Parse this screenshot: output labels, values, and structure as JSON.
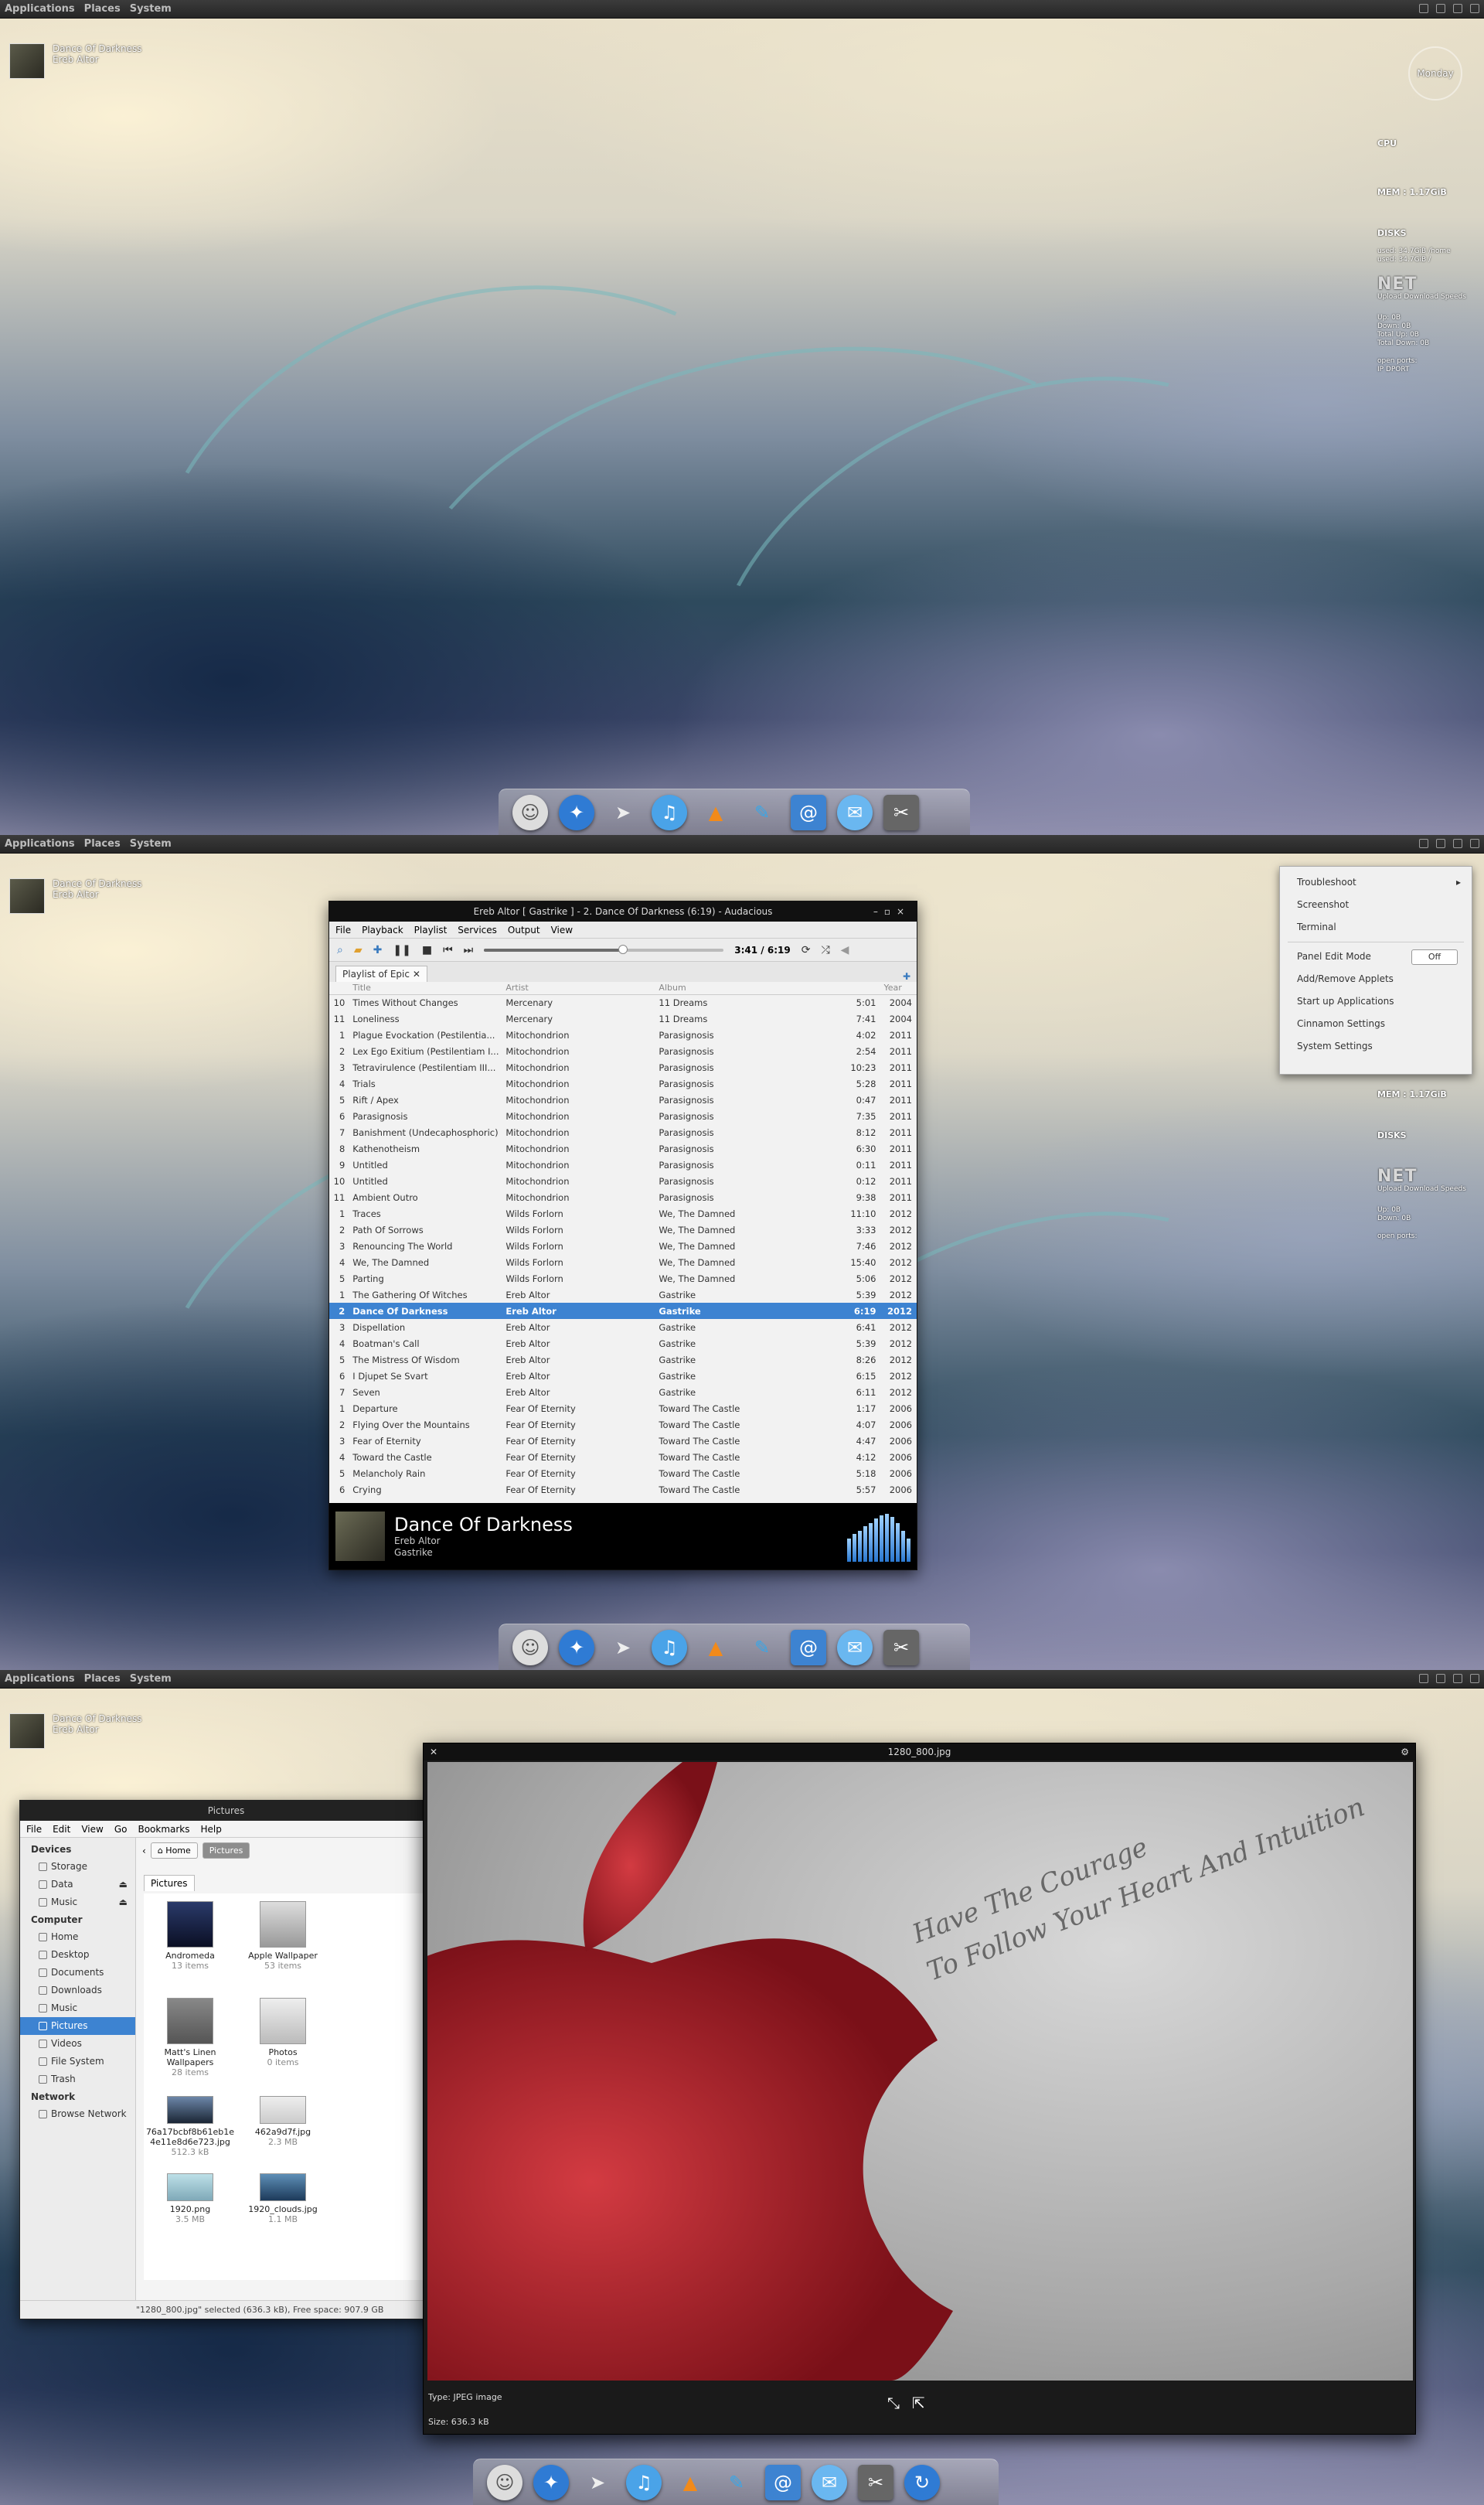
{
  "panel": {
    "menus": [
      "Applications",
      "Places",
      "System"
    ]
  },
  "now_playing": {
    "title": "Dance Of Darkness",
    "artist": "Ereb Altor"
  },
  "conky": {
    "day": "Monday",
    "cpu_label": "CPU",
    "mem_label": "MEM : 1.17GiB",
    "disks_label": "DISKS",
    "disk_used_1": "used: 34.7GiB /home",
    "disk_used_2": "used: 34.7GiB /",
    "net_label": "NET",
    "net_speeds": "Upload Download Speeds",
    "net_up": "Up: 0B",
    "net_down": "Down: 0B",
    "net_total_up": "Total Up: 0B",
    "net_total_down": "Total Down: 0B",
    "ports": "open ports:",
    "ports_cols": "IP       DPORT"
  },
  "dock": {
    "icons": [
      "finder-icon",
      "safari-icon",
      "cursor-icon",
      "itunes-icon",
      "vlc-icon",
      "feather-icon",
      "mail-icon",
      "chat-icon",
      "screenshot-icon"
    ],
    "extra_icon": "refresh-icon"
  },
  "audacious": {
    "title": "Ereb Altor [ Gastrike ] - 2. Dance Of Darkness (6:19) - Audacious",
    "menu": [
      "File",
      "Playback",
      "Playlist",
      "Services",
      "Output",
      "View"
    ],
    "time": "3:41 / 6:19",
    "progress": 0.58,
    "tab_label": "Playlist of Epic",
    "columns": [
      "Title",
      "Artist",
      "Album",
      "",
      "Year"
    ],
    "rows": [
      [
        "10",
        "Times Without Changes",
        "Mercenary",
        "11 Dreams",
        "5:01",
        "2004"
      ],
      [
        "11",
        "Loneliness",
        "Mercenary",
        "11 Dreams",
        "7:41",
        "2004"
      ],
      [
        "1",
        "Plague Evockation (Pestilentia...",
        "Mitochondrion",
        "Parasignosis",
        "4:02",
        "2011"
      ],
      [
        "2",
        "Lex Ego Exitium (Pestilentiam I...",
        "Mitochondrion",
        "Parasignosis",
        "2:54",
        "2011"
      ],
      [
        "3",
        "Tetravirulence (Pestilentiam III...",
        "Mitochondrion",
        "Parasignosis",
        "10:23",
        "2011"
      ],
      [
        "4",
        "Trials",
        "Mitochondrion",
        "Parasignosis",
        "5:28",
        "2011"
      ],
      [
        "5",
        "Rift / Apex",
        "Mitochondrion",
        "Parasignosis",
        "0:47",
        "2011"
      ],
      [
        "6",
        "Parasignosis",
        "Mitochondrion",
        "Parasignosis",
        "7:35",
        "2011"
      ],
      [
        "7",
        "Banishment (Undecaphosphoric)",
        "Mitochondrion",
        "Parasignosis",
        "8:12",
        "2011"
      ],
      [
        "8",
        "Kathenotheism",
        "Mitochondrion",
        "Parasignosis",
        "6:30",
        "2011"
      ],
      [
        "9",
        "Untitled",
        "Mitochondrion",
        "Parasignosis",
        "0:11",
        "2011"
      ],
      [
        "10",
        "Untitled",
        "Mitochondrion",
        "Parasignosis",
        "0:12",
        "2011"
      ],
      [
        "11",
        "Ambient Outro",
        "Mitochondrion",
        "Parasignosis",
        "9:38",
        "2011"
      ],
      [
        "1",
        "Traces",
        "Wilds Forlorn",
        "We, The Damned",
        "11:10",
        "2012"
      ],
      [
        "2",
        "Path Of Sorrows",
        "Wilds Forlorn",
        "We, The Damned",
        "3:33",
        "2012"
      ],
      [
        "3",
        "Renouncing The World",
        "Wilds Forlorn",
        "We, The Damned",
        "7:46",
        "2012"
      ],
      [
        "4",
        "We, The Damned",
        "Wilds Forlorn",
        "We, The Damned",
        "15:40",
        "2012"
      ],
      [
        "5",
        "Parting",
        "Wilds Forlorn",
        "We, The Damned",
        "5:06",
        "2012"
      ],
      [
        "1",
        "The Gathering Of Witches",
        "Ereb Altor",
        "Gastrike",
        "5:39",
        "2012"
      ],
      [
        "2",
        "Dance Of Darkness",
        "Ereb Altor",
        "Gastrike",
        "6:19",
        "2012"
      ],
      [
        "3",
        "Dispellation",
        "Ereb Altor",
        "Gastrike",
        "6:41",
        "2012"
      ],
      [
        "4",
        "Boatman's Call",
        "Ereb Altor",
        "Gastrike",
        "5:39",
        "2012"
      ],
      [
        "5",
        "The Mistress Of Wisdom",
        "Ereb Altor",
        "Gastrike",
        "8:26",
        "2012"
      ],
      [
        "6",
        "I Djupet Se Svart",
        "Ereb Altor",
        "Gastrike",
        "6:15",
        "2012"
      ],
      [
        "7",
        "Seven",
        "Ereb Altor",
        "Gastrike",
        "6:11",
        "2012"
      ],
      [
        "1",
        "Departure",
        "Fear Of Eternity",
        "Toward The Castle",
        "1:17",
        "2006"
      ],
      [
        "2",
        "Flying Over the Mountains",
        "Fear Of Eternity",
        "Toward The Castle",
        "4:07",
        "2006"
      ],
      [
        "3",
        "Fear of Eternity",
        "Fear Of Eternity",
        "Toward The Castle",
        "4:47",
        "2006"
      ],
      [
        "4",
        "Toward the Castle",
        "Fear Of Eternity",
        "Toward The Castle",
        "4:12",
        "2006"
      ],
      [
        "5",
        "Melancholy Rain",
        "Fear Of Eternity",
        "Toward The Castle",
        "5:18",
        "2006"
      ],
      [
        "6",
        "Crying",
        "Fear Of Eternity",
        "Toward The Castle",
        "5:57",
        "2006"
      ]
    ],
    "selected_index": 19,
    "info": {
      "title": "Dance Of Darkness",
      "artist": "Ereb Altor",
      "album": "Gastrike"
    }
  },
  "context_menu": {
    "items": [
      "Troubleshoot",
      "Screenshot",
      "Terminal"
    ],
    "items2": [
      "Panel Edit Mode",
      "Add/Remove Applets",
      "Start up Applications",
      "Cinnamon Settings",
      "System Settings"
    ],
    "toggle": "Off"
  },
  "nautilus": {
    "title": "Pictures",
    "menu": [
      "File",
      "Edit",
      "View",
      "Go",
      "Bookmarks",
      "Help"
    ],
    "devices_label": "Devices",
    "devices": [
      "Storage",
      "Data",
      "Music"
    ],
    "computer_label": "Computer",
    "computer": [
      "Home",
      "Desktop",
      "Documents",
      "Downloads",
      "Music",
      "Pictures",
      "Videos",
      "File System",
      "Trash"
    ],
    "network_label": "Network",
    "network": [
      "Browse Network"
    ],
    "crumb_home": "Home",
    "crumb_current": "Pictures",
    "tab": "Pictures",
    "items": [
      {
        "name": "Andromeda",
        "sub": "13 items"
      },
      {
        "name": "Apple Wallpaper",
        "sub": "53 items"
      },
      {
        "name": "Matt's Linen Wallpapers",
        "sub": "28 items"
      },
      {
        "name": "Photos",
        "sub": "0 items"
      },
      {
        "name": "76a17bcbf8b61eb1e4e11e8d6e723.jpg",
        "sub": "512.3 kB"
      },
      {
        "name": "462a9d7f.jpg",
        "sub": "2.3 MB"
      },
      {
        "name": "1920.png",
        "sub": "3.5 MB"
      },
      {
        "name": "1920_clouds.jpg",
        "sub": "1.1 MB"
      }
    ],
    "status": "\"1280_800.jpg\" selected (636.3 kB), Free space: 907.9 GB"
  },
  "viewer": {
    "title": "1280_800.jpg",
    "slogan_1": "Have The Courage",
    "slogan_2": "To Follow Your Heart And Intuition",
    "type": "Type: JPEG image",
    "size": "Size: 636.3 kB"
  },
  "colors": {
    "selection": "#3d83d1",
    "panel": "#2c2c2c",
    "accent_red": "#b3202a"
  }
}
